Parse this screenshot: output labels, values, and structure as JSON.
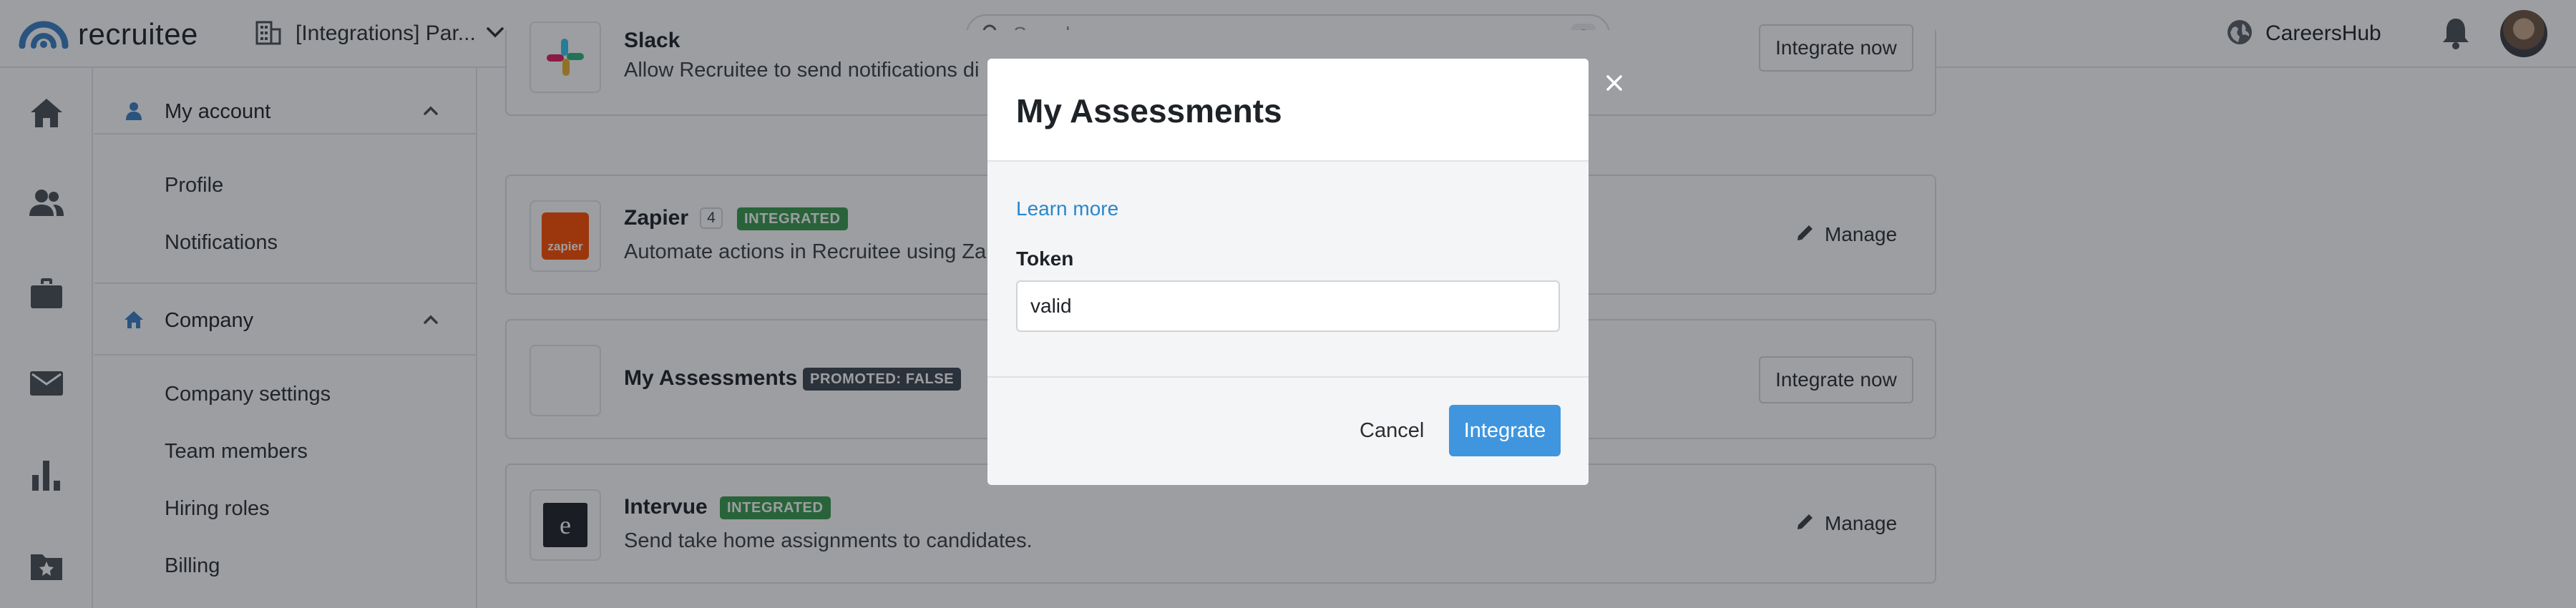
{
  "app": {
    "logo_text": "recruitee"
  },
  "header": {
    "org_label": "[Integrations] Par...",
    "search": {
      "placeholder": "Search",
      "shortcut": "S"
    },
    "careers_label": "CareersHub"
  },
  "rail": {
    "icons": [
      "home-icon",
      "people-icon",
      "briefcase-icon",
      "mail-icon",
      "bar-chart-icon",
      "starred-folder-icon"
    ]
  },
  "sidebar": {
    "my_account": {
      "label": "My account",
      "items": [
        "Profile",
        "Notifications"
      ]
    },
    "company": {
      "label": "Company",
      "items": [
        "Company settings",
        "Team members",
        "Hiring roles",
        "Billing"
      ]
    }
  },
  "integrations": [
    {
      "name": "Slack",
      "description": "Allow Recruitee to send notifications di",
      "action": "Integrate now"
    },
    {
      "name": "Zapier",
      "count": "4",
      "badge": "INTEGRATED",
      "description": "Automate actions in Recruitee using Za",
      "action": "Manage",
      "logo_text": "zapier"
    },
    {
      "name": "My Assessments",
      "badge": "PROMOTED: FALSE",
      "action": "Integrate now"
    },
    {
      "name": "Intervue",
      "badge": "INTEGRATED",
      "description": "Send take home assignments to candidates.",
      "action": "Manage",
      "logo_text": "e"
    }
  ],
  "modal": {
    "title": "My Assessments",
    "learn_more": "Learn more",
    "token_label": "Token",
    "token_value": "valid",
    "cancel_label": "Cancel",
    "integrate_label": "Integrate"
  },
  "colors": {
    "primary": "#3f96de",
    "link": "#2a87c9",
    "integrated_badge": "#3a9a4e",
    "promoted_badge": "#3f4650",
    "brand_icon": "#3b80c4"
  }
}
